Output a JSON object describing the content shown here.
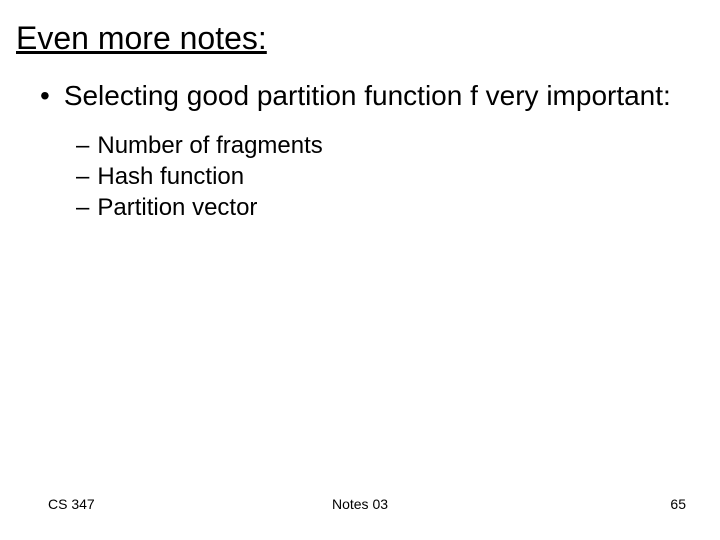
{
  "title": "Even more notes:",
  "bullets": [
    {
      "text": "Selecting good partition function f very important:",
      "sub": [
        "Number of fragments",
        "Hash function",
        "Partition vector"
      ]
    }
  ],
  "footer": {
    "left": "CS 347",
    "center": "Notes 03",
    "right": "65"
  }
}
